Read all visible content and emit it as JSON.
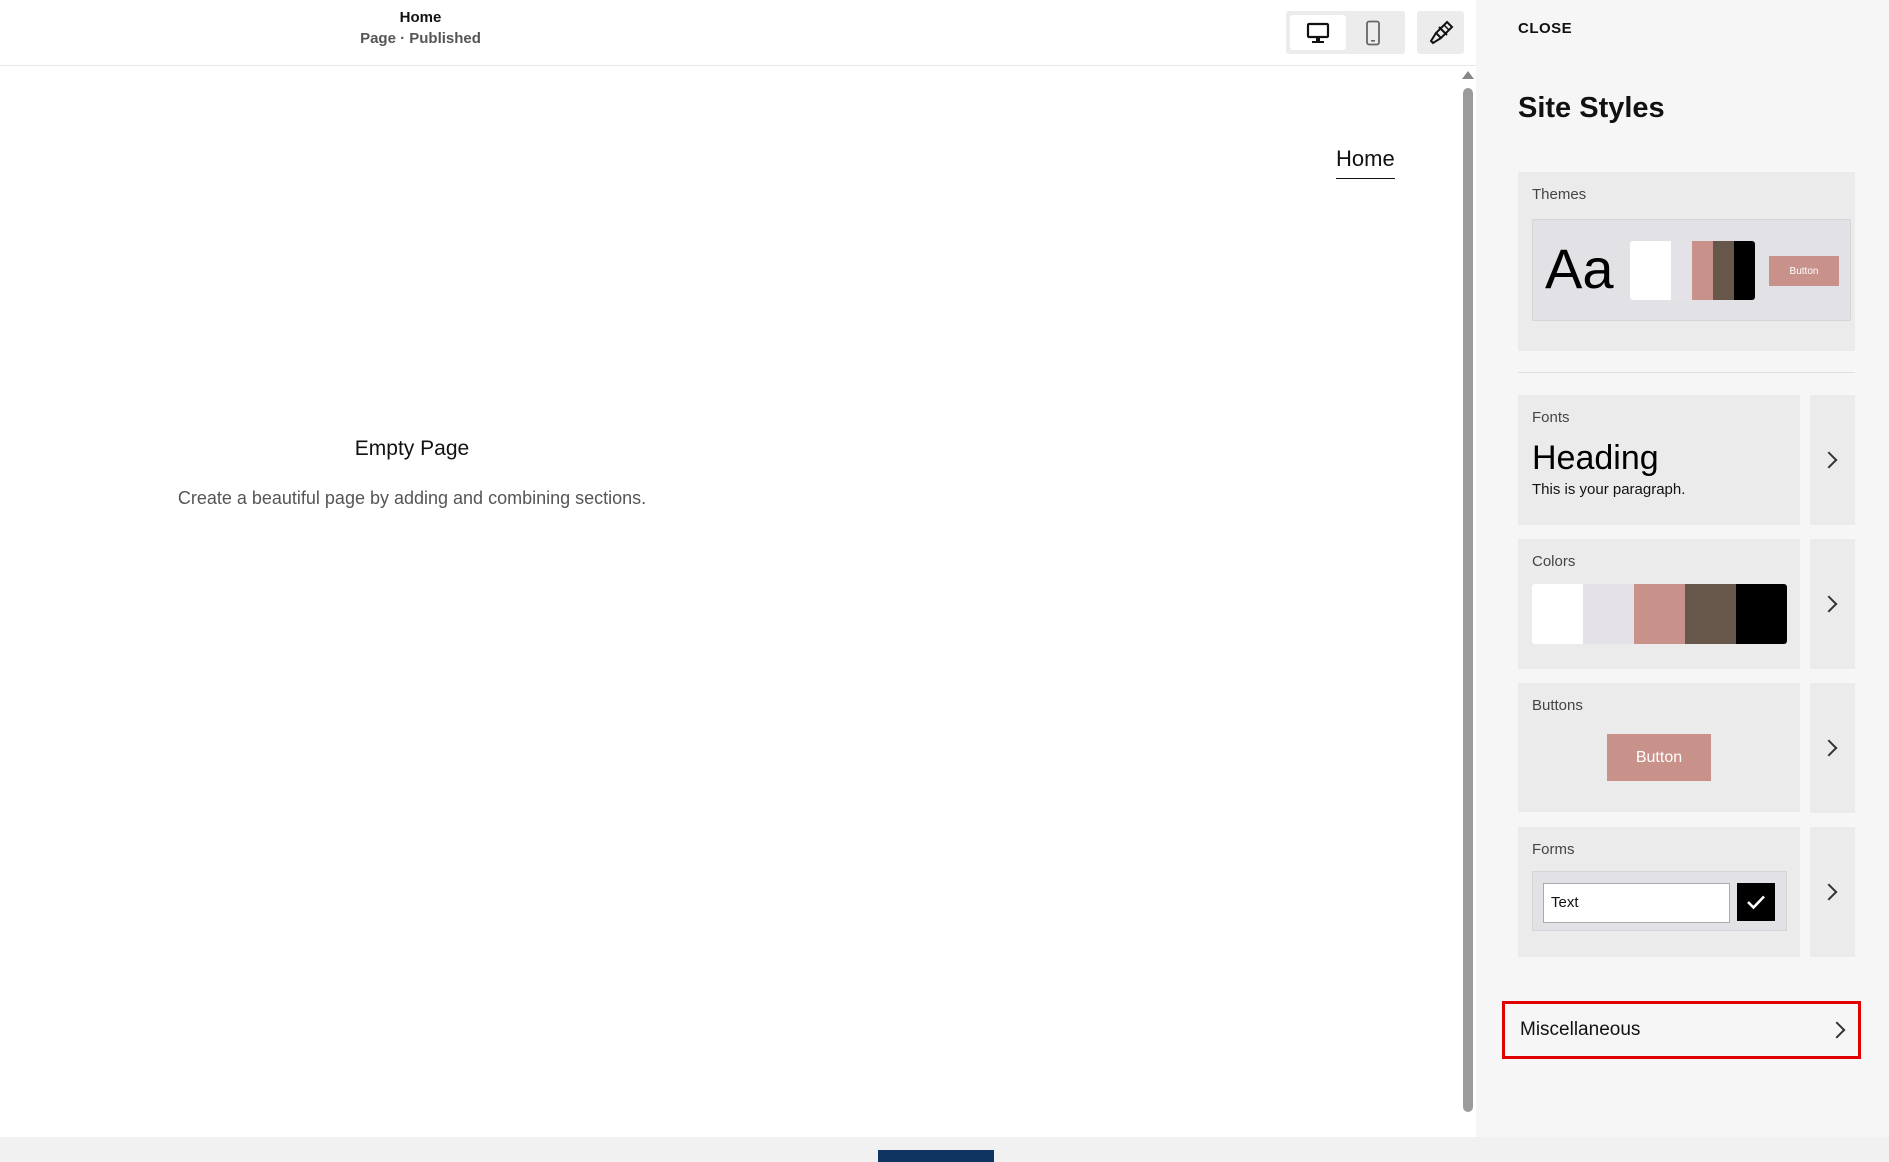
{
  "topbar": {
    "page_title": "Home",
    "page_status": "Page · Published",
    "desktop_view_icon": "desktop-monitor-icon",
    "mobile_view_icon": "mobile-phone-icon",
    "site_styles_icon": "paintbrush-icon"
  },
  "canvas": {
    "nav_link": "Home",
    "empty_title": "Empty Page",
    "empty_description": "Create a beautiful page by adding and combining sections."
  },
  "panel": {
    "close_label": "CLOSE",
    "title": "Site Styles",
    "themes": {
      "label": "Themes",
      "preview_text": "Aa",
      "button_label": "Button",
      "swatches": [
        "#ffffff",
        "#e4e2e6",
        "#c8928a",
        "#67574a",
        "#000000"
      ]
    },
    "fonts": {
      "label": "Fonts",
      "heading_sample": "Heading",
      "paragraph_sample": "This is your paragraph."
    },
    "colors": {
      "label": "Colors",
      "swatches": [
        "#ffffff",
        "#e4e2e6",
        "#c8928a",
        "#67574a",
        "#000000"
      ]
    },
    "buttons": {
      "label": "Buttons",
      "button_label": "Button",
      "accent": "#c8928a"
    },
    "forms": {
      "label": "Forms",
      "input_value": "Text"
    },
    "miscellaneous": {
      "label": "Miscellaneous",
      "highlight_color": "#e00000"
    }
  }
}
